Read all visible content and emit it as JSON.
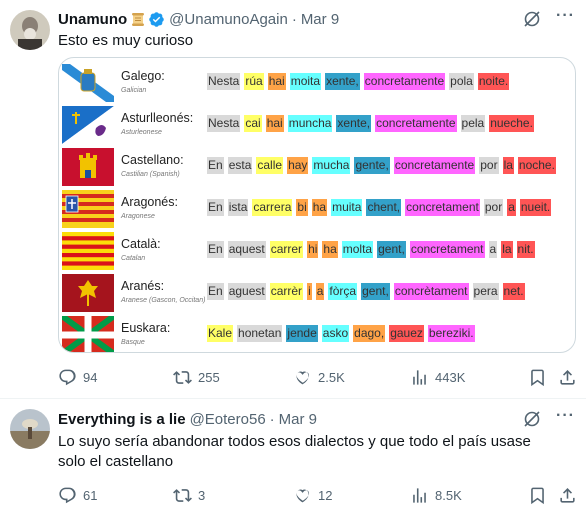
{
  "tweet1": {
    "name": "Unamuno",
    "name_emoji": "scroll-emoji",
    "verified": true,
    "handle": "@UnamunoAgain",
    "dot": "·",
    "date": "Mar 9",
    "text": "Esto es muy curioso",
    "replies": "94",
    "retweets": "255",
    "likes": "2.5K",
    "views": "443K"
  },
  "media": {
    "rows": [
      {
        "name": "Galego:",
        "sub": "Galician",
        "flag": "galicia-flag",
        "words": [
          {
            "t": "Nesta",
            "c": "#d9d9d9"
          },
          {
            "t": "rúa",
            "c": "#ffff66"
          },
          {
            "t": "hai",
            "c": "#ffa347"
          },
          {
            "t": "moita",
            "c": "#66ffff"
          },
          {
            "t": "xente,",
            "c": "#33a1c9"
          },
          {
            "t": "concretamente",
            "c": "#ff66ff"
          },
          {
            "t": "pola",
            "c": "#d9d9d9"
          },
          {
            "t": "noite.",
            "c": "#ff5555"
          }
        ]
      },
      {
        "name": "Asturlleonés:",
        "sub": "Asturleonese",
        "flag": "asturias-leon-flag",
        "words": [
          {
            "t": "Nesta",
            "c": "#d9d9d9"
          },
          {
            "t": "cai",
            "c": "#ffff66"
          },
          {
            "t": "hai",
            "c": "#ffa347"
          },
          {
            "t": "muncha",
            "c": "#66ffff"
          },
          {
            "t": "xente,",
            "c": "#33a1c9"
          },
          {
            "t": "concretamente",
            "c": "#ff66ff"
          },
          {
            "t": "pela",
            "c": "#d9d9d9"
          },
          {
            "t": "nueche.",
            "c": "#ff5555"
          }
        ]
      },
      {
        "name": "Castellano:",
        "sub": "Castilian (Spanish)",
        "flag": "castilla-flag",
        "words": [
          {
            "t": "En",
            "c": "#d9d9d9"
          },
          {
            "t": "esta",
            "c": "#d9d9d9"
          },
          {
            "t": "calle",
            "c": "#ffff66"
          },
          {
            "t": "hay",
            "c": "#ffa347"
          },
          {
            "t": "mucha",
            "c": "#66ffff"
          },
          {
            "t": "gente,",
            "c": "#33a1c9"
          },
          {
            "t": "concretamente",
            "c": "#ff66ff"
          },
          {
            "t": "por",
            "c": "#d9d9d9"
          },
          {
            "t": "la",
            "c": "#ff5555"
          },
          {
            "t": "noche.",
            "c": "#ff5555"
          }
        ]
      },
      {
        "name": "Aragonés:",
        "sub": "Aragonese",
        "flag": "aragon-flag",
        "words": [
          {
            "t": "En",
            "c": "#d9d9d9"
          },
          {
            "t": "ista",
            "c": "#d9d9d9"
          },
          {
            "t": "carrera",
            "c": "#ffff66"
          },
          {
            "t": "bi",
            "c": "#ffa347"
          },
          {
            "t": "ha",
            "c": "#ffa347"
          },
          {
            "t": "muita",
            "c": "#66ffff"
          },
          {
            "t": "chent,",
            "c": "#33a1c9"
          },
          {
            "t": "concretament",
            "c": "#ff66ff"
          },
          {
            "t": "por",
            "c": "#d9d9d9"
          },
          {
            "t": "a",
            "c": "#ff5555"
          },
          {
            "t": "nueit.",
            "c": "#ff5555"
          }
        ]
      },
      {
        "name": "Català:",
        "sub": "Catalan",
        "flag": "catalunya-flag",
        "words": [
          {
            "t": "En",
            "c": "#d9d9d9"
          },
          {
            "t": "aquest",
            "c": "#d9d9d9"
          },
          {
            "t": "carrer",
            "c": "#ffff66"
          },
          {
            "t": "hi",
            "c": "#ffa347"
          },
          {
            "t": "ha",
            "c": "#ffa347"
          },
          {
            "t": "molta",
            "c": "#66ffff"
          },
          {
            "t": "gent,",
            "c": "#33a1c9"
          },
          {
            "t": "concretament",
            "c": "#ff66ff"
          },
          {
            "t": "a",
            "c": "#d9d9d9"
          },
          {
            "t": "la",
            "c": "#ff5555"
          },
          {
            "t": "nit.",
            "c": "#ff5555"
          }
        ]
      },
      {
        "name": "Aranés:",
        "sub": "Aranese (Gascon, Occitan)",
        "flag": "aran-flag",
        "words": [
          {
            "t": "En",
            "c": "#d9d9d9"
          },
          {
            "t": "aguest",
            "c": "#d9d9d9"
          },
          {
            "t": "carrèr",
            "c": "#ffff66"
          },
          {
            "t": "i",
            "c": "#ffa347"
          },
          {
            "t": "a",
            "c": "#ffa347"
          },
          {
            "t": "fòrça",
            "c": "#66ffff"
          },
          {
            "t": "gent,",
            "c": "#33a1c9"
          },
          {
            "t": "concrètament",
            "c": "#ff66ff"
          },
          {
            "t": "pera",
            "c": "#d9d9d9"
          },
          {
            "t": "net.",
            "c": "#ff5555"
          }
        ]
      },
      {
        "name": "Euskara:",
        "sub": "Basque",
        "flag": "euskadi-flag",
        "words": [
          {
            "t": "Kale",
            "c": "#ffff66"
          },
          {
            "t": "honetan",
            "c": "#d9d9d9"
          },
          {
            "t": "jende",
            "c": "#33a1c9"
          },
          {
            "t": "asko",
            "c": "#66ffff"
          },
          {
            "t": "dago,",
            "c": "#ffa347"
          },
          {
            "t": "gauez",
            "c": "#ff5555"
          },
          {
            "t": "bereziki.",
            "c": "#ff66ff"
          }
        ]
      }
    ]
  },
  "tweet2": {
    "name": "Everything is a lie",
    "handle": "@Eotero56",
    "dot": "·",
    "date": "Mar 9",
    "text": "Lo suyo sería abandonar todos esos dialectos y que todo el país usase solo el castellano",
    "replies": "61",
    "retweets": "3",
    "likes": "12",
    "views": "8.5K"
  },
  "icons": {
    "reply": "reply-icon",
    "retweet": "retweet-icon",
    "like": "heart-icon",
    "views": "views-icon",
    "bookmark": "bookmark-icon",
    "share": "share-icon",
    "grok": "grok-icon",
    "more": "more-icon",
    "verified": "verified-badge-icon"
  },
  "colors": {
    "verified": "#1d9bf0",
    "muted": "#536471",
    "text": "#0f1419"
  }
}
